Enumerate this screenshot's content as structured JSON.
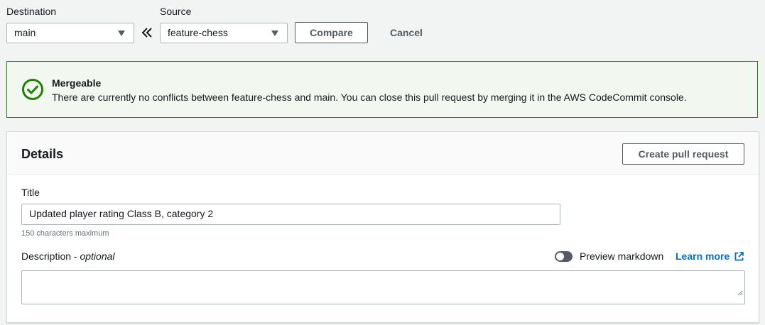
{
  "compare_bar": {
    "destination_label": "Destination",
    "destination_value": "main",
    "source_label": "Source",
    "source_value": "feature-chess",
    "compare_button": "Compare",
    "cancel_button": "Cancel"
  },
  "alert": {
    "title": "Mergeable",
    "message": "There are currently no conflicts between feature-chess and main. You can close this pull request by merging it in the AWS CodeCommit console.",
    "color": "#1d8102"
  },
  "details": {
    "heading": "Details",
    "create_button": "Create pull request",
    "title_label": "Title",
    "title_value": "Updated player rating Class B, category 2",
    "title_hint": "150 characters maximum",
    "description_label": "Description - ",
    "description_optional": "optional",
    "description_value": "",
    "preview_label": "Preview markdown",
    "learn_more": "Learn more"
  },
  "colors": {
    "link": "#0073bb",
    "success": "#1d8102"
  }
}
